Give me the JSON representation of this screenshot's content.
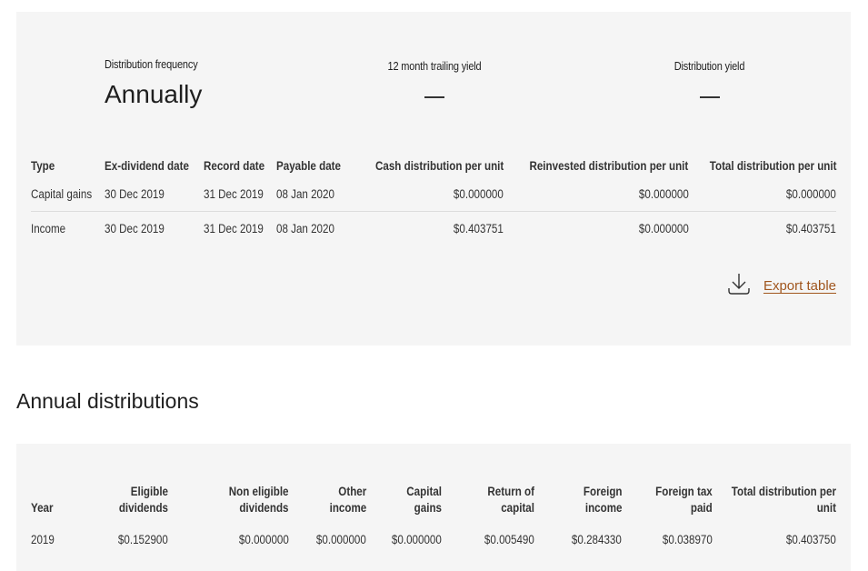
{
  "summary": {
    "distribution_frequency": {
      "label": "Distribution frequency",
      "value": "Annually"
    },
    "trailing_yield": {
      "label": "12 month trailing yield",
      "value": "—"
    },
    "distribution_yield": {
      "label": "Distribution yield",
      "value": "—"
    }
  },
  "distributions_table": {
    "headers": [
      "Type",
      "Ex-dividend date",
      "Record date",
      "Payable date",
      "Cash distribution per unit",
      "Reinvested distribution per unit",
      "Total distribution per unit"
    ],
    "rows": [
      [
        "Capital gains",
        "30 Dec 2019",
        "31 Dec 2019",
        "08 Jan 2020",
        "$0.000000",
        "$0.000000",
        "$0.000000"
      ],
      [
        "Income",
        "30 Dec 2019",
        "31 Dec 2019",
        "08 Jan 2020",
        "$0.403751",
        "$0.000000",
        "$0.403751"
      ]
    ]
  },
  "export": {
    "label": "Export table",
    "icon": "download-icon",
    "color": "#a0561e"
  },
  "annual": {
    "title": "Annual distributions",
    "headers": [
      [
        "Year"
      ],
      [
        "Eligible",
        "dividends"
      ],
      [
        "Non eligible",
        "dividends"
      ],
      [
        "Other",
        "income"
      ],
      [
        "Capital",
        "gains"
      ],
      [
        "Return of",
        "capital"
      ],
      [
        "Foreign",
        "income"
      ],
      [
        "Foreign tax",
        "paid"
      ],
      [
        "Total distribution per",
        "unit"
      ]
    ],
    "rows": [
      [
        "2019",
        "$0.152900",
        "$0.000000",
        "$0.000000",
        "$0.000000",
        "$0.005490",
        "$0.284330",
        "$0.038970",
        "$0.403750"
      ]
    ]
  }
}
